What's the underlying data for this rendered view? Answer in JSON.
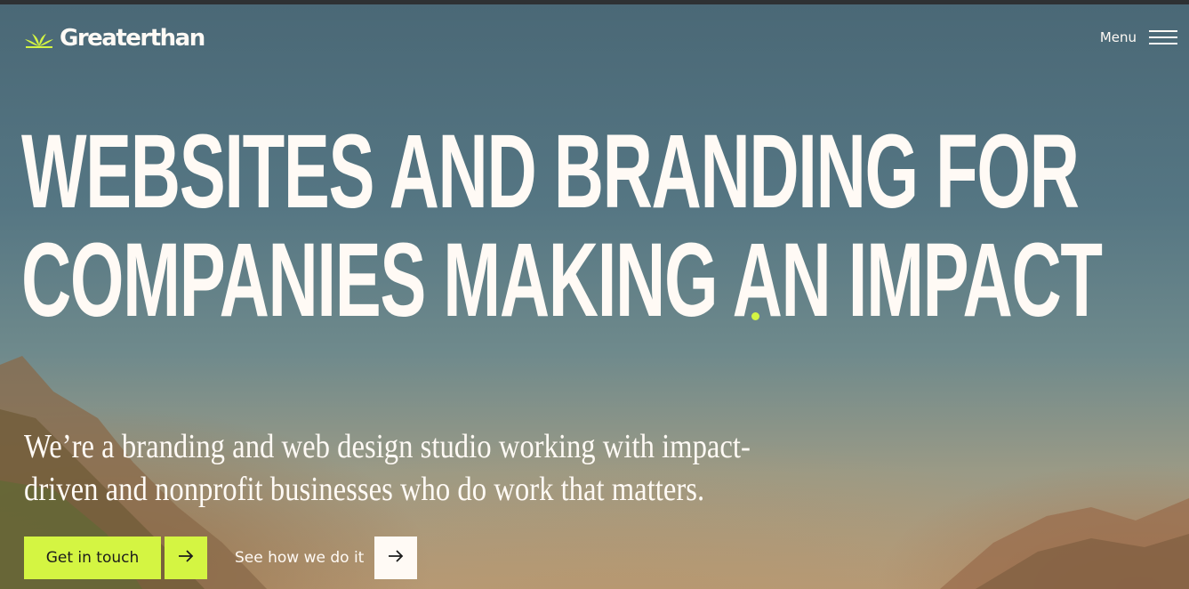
{
  "brand": {
    "name": "Greaterthan",
    "logo_icon": "sprout-icon",
    "accent_color": "#d4f542"
  },
  "nav": {
    "menu_label": "Menu",
    "menu_icon": "hamburger-icon"
  },
  "hero": {
    "headline_line1": "WEBSITES AND BRANDING FOR",
    "headline_line2": "COMPANIES MAKING AN IMPACT",
    "subtitle": "We’re a branding and web design studio working with impact-driven and nonprofit businesses who do work that matters."
  },
  "cta": {
    "primary_label": "Get in touch",
    "primary_icon": "arrow-right-icon",
    "secondary_label": "See how we do it",
    "secondary_icon": "arrow-right-icon"
  }
}
